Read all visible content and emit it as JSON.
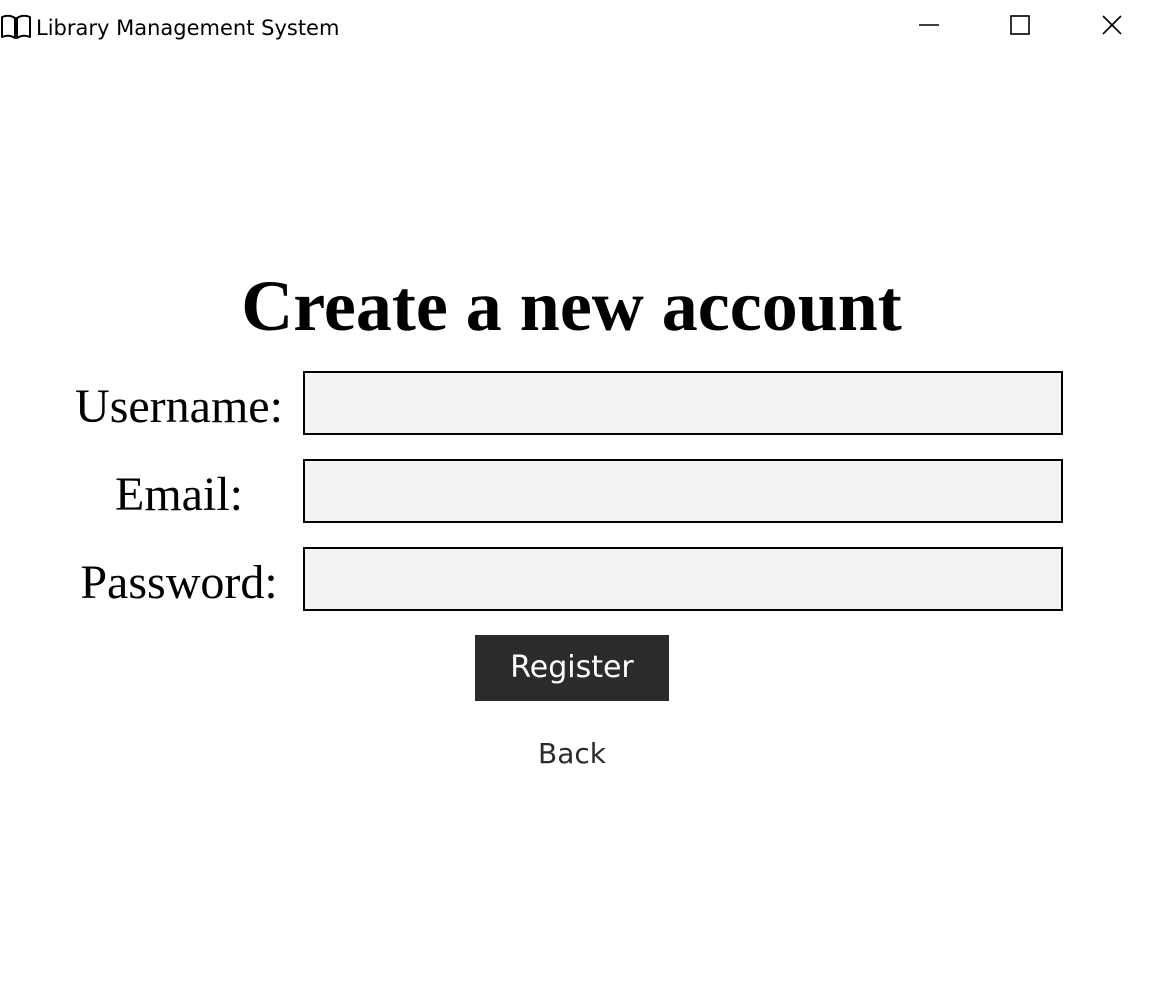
{
  "window": {
    "title": "Library Management System",
    "app_icon": "open-book-icon",
    "controls": [
      "minimize-icon",
      "maximize-icon",
      "close-icon"
    ]
  },
  "form": {
    "heading": "Create a new account",
    "username_label": "Username:",
    "username_value": "",
    "email_label": "Email:",
    "email_value": "",
    "password_label": "Password:",
    "password_value": "",
    "register_label": "Register",
    "back_label": "Back"
  },
  "colors": {
    "field_background": "#f3f3f3",
    "button_background": "#2b2b2b",
    "button_text": "#ffffff"
  }
}
